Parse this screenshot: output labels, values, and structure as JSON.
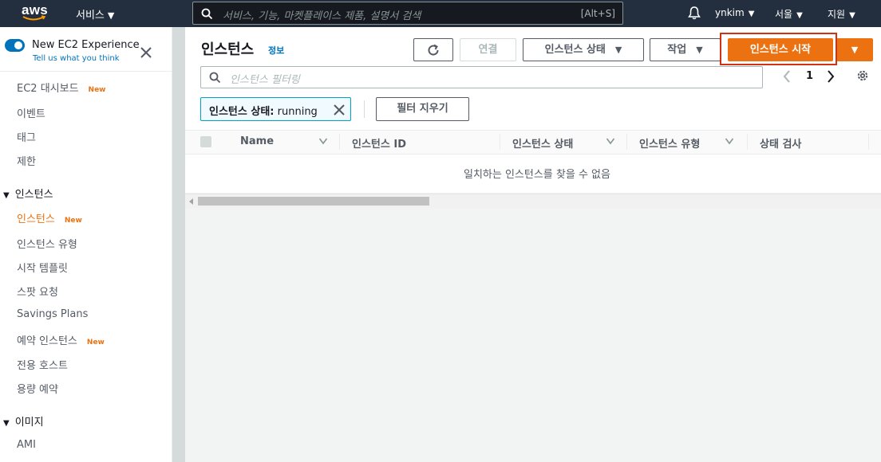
{
  "topnav": {
    "logo_text": "aws",
    "services_label": "서비스",
    "search_placeholder": "서비스, 기능, 마켓플레이스 제품, 설명서 검색",
    "search_shortcut": "[Alt+S]",
    "user": "ynkim",
    "region": "서울",
    "support": "지원"
  },
  "sidebar": {
    "new_experience_title": "New EC2 Experience",
    "new_experience_link": "Tell us what you think",
    "items": [
      {
        "label": "EC2 대시보드",
        "badge": "New"
      },
      {
        "label": "이벤트"
      },
      {
        "label": "태그"
      },
      {
        "label": "제한"
      }
    ],
    "section_instances": "인스턴스",
    "instance_items": [
      {
        "label": "인스턴스",
        "badge": "New"
      },
      {
        "label": "인스턴스 유형"
      },
      {
        "label": "시작 템플릿"
      },
      {
        "label": "스팟 요청"
      },
      {
        "label": "Savings Plans"
      },
      {
        "label": "예약 인스턴스",
        "badge": "New"
      },
      {
        "label": "전용 호스트"
      },
      {
        "label": "용량 예약"
      }
    ],
    "section_images": "이미지",
    "image_items": [
      {
        "label": "AMI"
      }
    ]
  },
  "main": {
    "title": "인스턴스",
    "info_link": "정보",
    "buttons": {
      "connect": "연결",
      "instance_state": "인스턴스 상태",
      "actions": "작업",
      "launch": "인스턴스 시작"
    },
    "filter_placeholder": "인스턴스 필터링",
    "page_number": "1",
    "chip": {
      "key": "인스턴스 상태:",
      "value": "running"
    },
    "clear_filters": "필터 지우기",
    "columns": [
      "Name",
      "인스턴스 ID",
      "인스턴스 상태",
      "인스턴스 유형",
      "상태 검사"
    ],
    "empty_message": "일치하는 인스턴스를 찾을 수 없음"
  },
  "colors": {
    "nav_bg": "#232f3e",
    "accent_orange": "#ec7211",
    "link_blue": "#0073bb",
    "highlight_red": "#d13212"
  }
}
